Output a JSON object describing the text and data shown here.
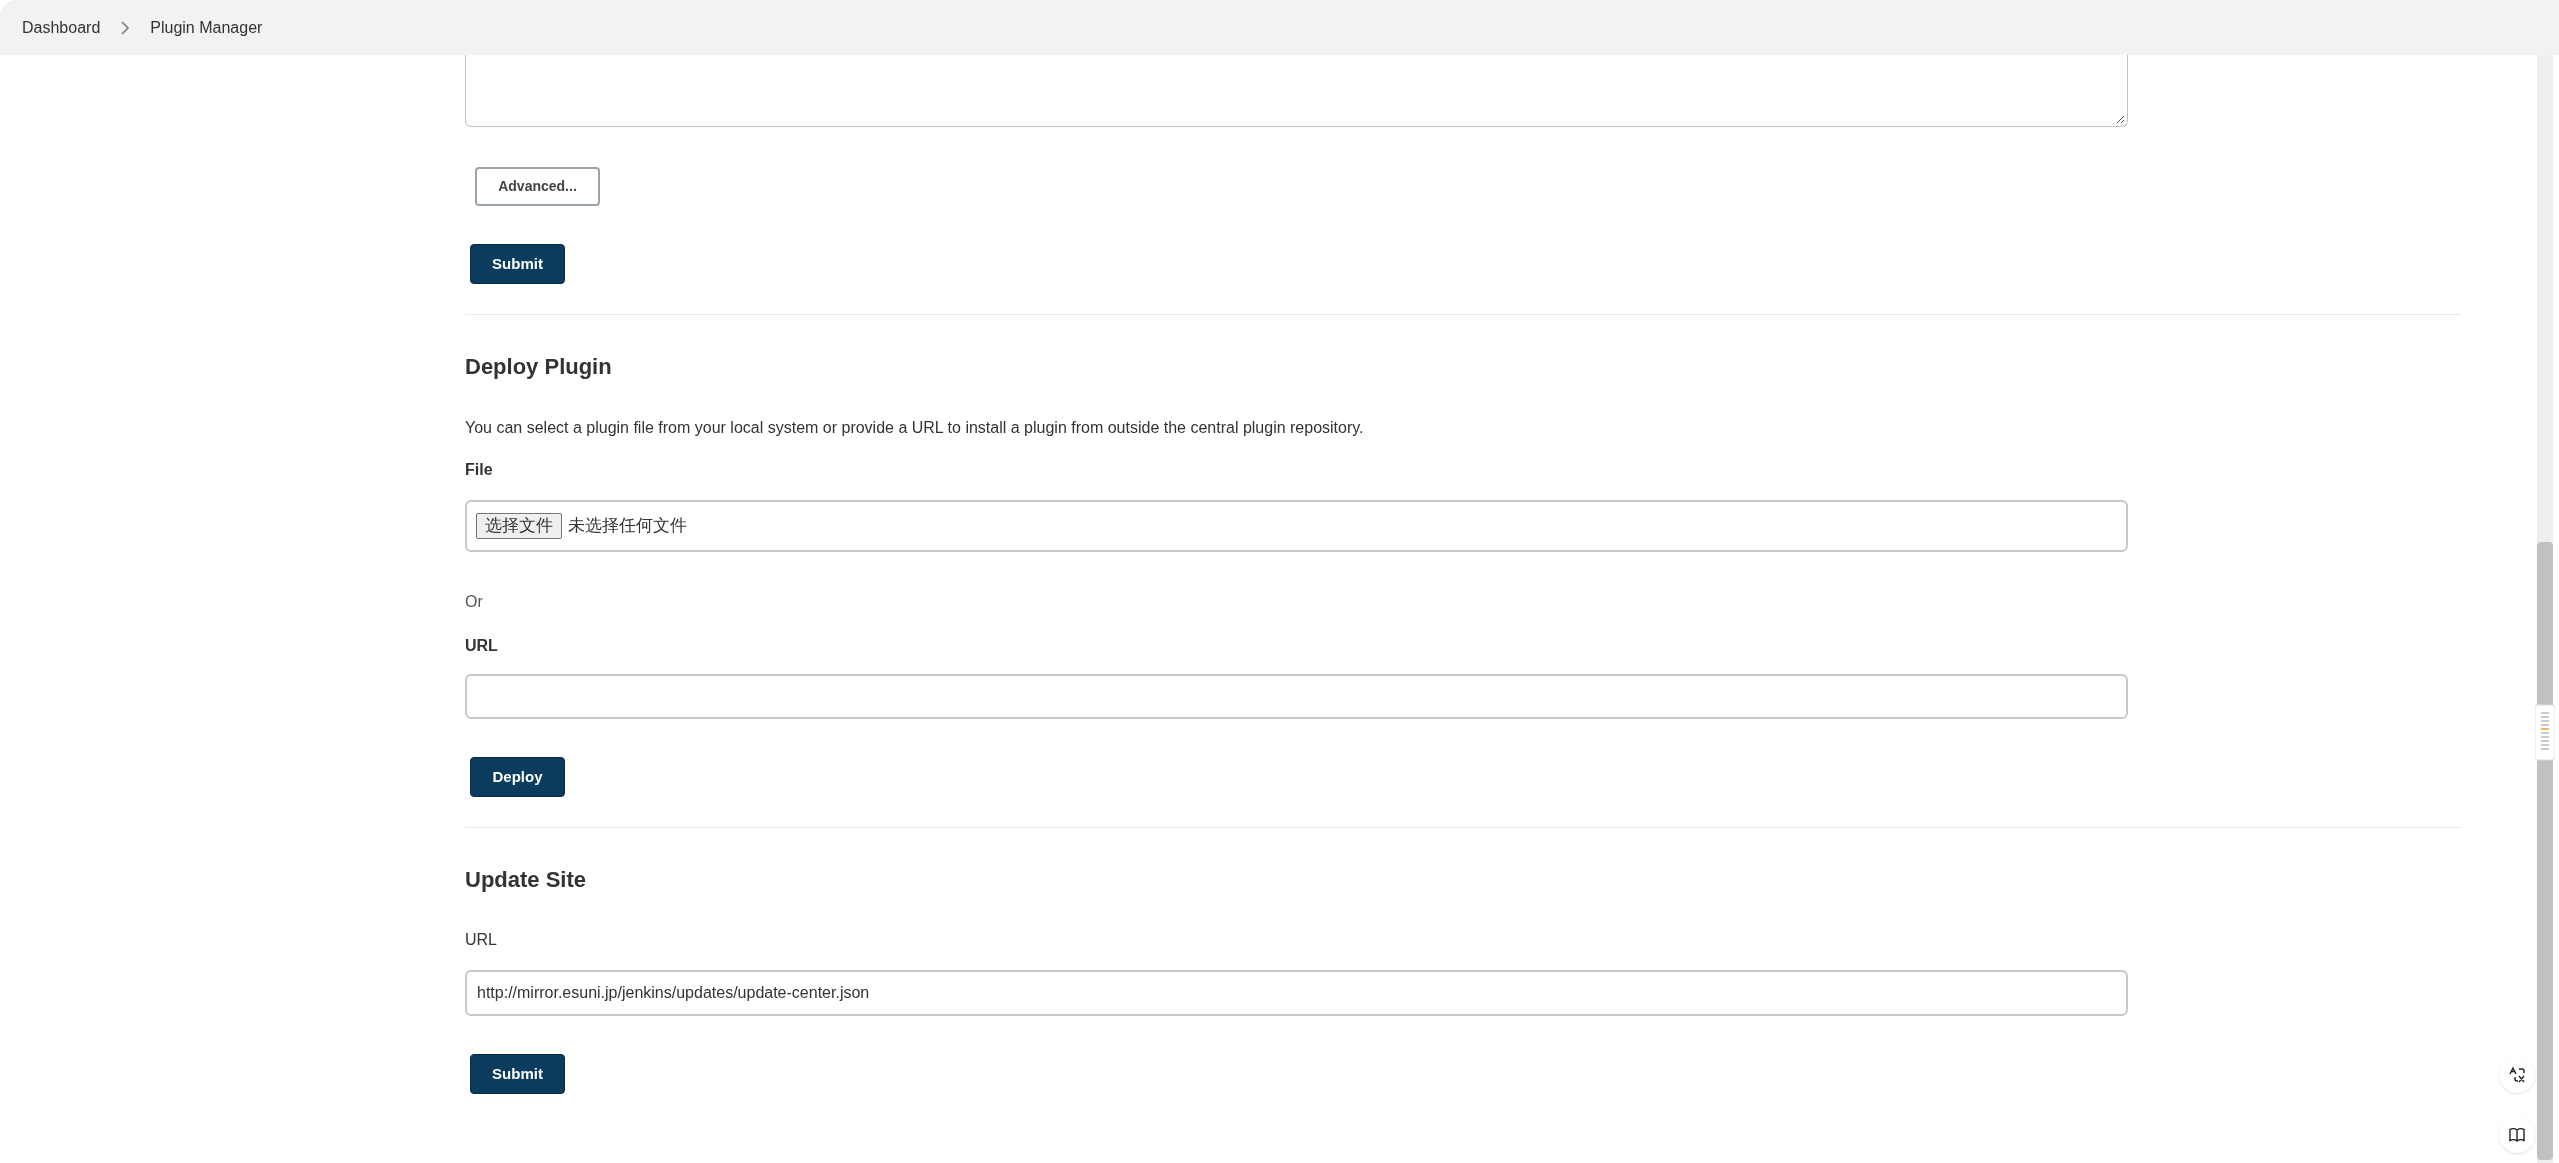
{
  "breadcrumbs": [
    {
      "label": "Dashboard"
    },
    {
      "label": "Plugin Manager"
    }
  ],
  "advanced_section": {
    "advanced_button": "Advanced...",
    "submit_button": "Submit"
  },
  "deploy_plugin": {
    "title": "Deploy Plugin",
    "description": "You can select a plugin file from your local system or provide a URL to install a plugin from outside the central plugin repository.",
    "file_label": "File",
    "file_button": "选择文件",
    "file_status": "未选择任何文件",
    "or_text": "Or",
    "url_label": "URL",
    "deploy_button": "Deploy"
  },
  "update_site": {
    "title": "Update Site",
    "url_label": "URL",
    "url_value": "http://mirror.esuni.jp/jenkins/updates/update-center.json",
    "submit_button": "Submit"
  }
}
